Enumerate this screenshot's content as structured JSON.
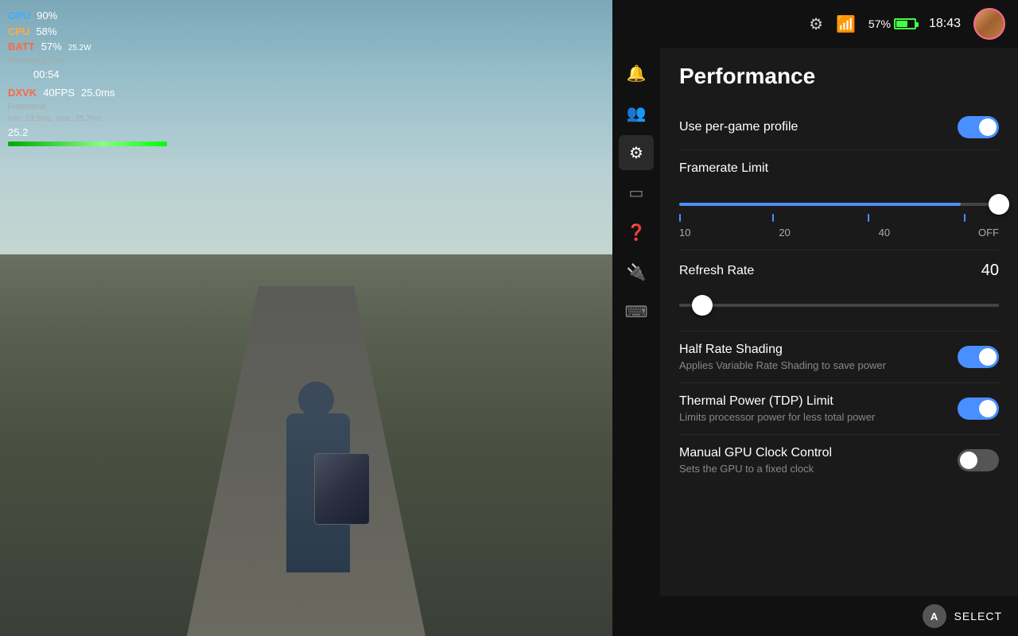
{
  "hud": {
    "gpu_label": "GPU",
    "gpu_value": "90%",
    "cpu_label": "CPU",
    "cpu_value": "58%",
    "batt_label": "BATT",
    "batt_value": "57%",
    "batt_watt": "25.2W",
    "batt_remaining": "Remaining Time",
    "batt_time": "00:54",
    "dxvk_label": "DXVK",
    "dxvk_fps": "40FPS",
    "dxvk_ms": "25.0ms",
    "frametime_label": "Frametime",
    "frametime_detail": "min: 19.5ms, max: 25.7ms",
    "frametime_val": "25.2"
  },
  "topbar": {
    "battery_pct": "57%",
    "time": "18:43"
  },
  "panel": {
    "title": "Performance",
    "settings": [
      {
        "id": "per-game-profile",
        "label": "Use per-game profile",
        "type": "toggle",
        "value": true
      }
    ],
    "framerate_section": {
      "label": "Framerate Limit",
      "ticks": [
        "10",
        "20",
        "40",
        "OFF"
      ]
    },
    "refresh_rate": {
      "label": "Refresh Rate",
      "value": "40"
    },
    "half_rate_shading": {
      "label": "Half Rate Shading",
      "sublabel": "Applies Variable Rate Shading to save power",
      "value": true
    },
    "tdp_limit": {
      "label": "Thermal Power (TDP) Limit",
      "sublabel": "Limits processor power for less total power",
      "value": true
    },
    "gpu_clock": {
      "label": "Manual GPU Clock Control",
      "sublabel": "Sets the GPU to a fixed clock",
      "value": false
    }
  },
  "sidebar": {
    "icons": [
      {
        "id": "notification",
        "symbol": "🔔"
      },
      {
        "id": "friends",
        "symbol": "👥"
      },
      {
        "id": "settings",
        "symbol": "⚙"
      },
      {
        "id": "display",
        "symbol": "🖥"
      },
      {
        "id": "help",
        "symbol": "❓"
      },
      {
        "id": "power",
        "symbol": "🔌"
      },
      {
        "id": "keyboard",
        "symbol": "⌨"
      }
    ]
  },
  "bottom": {
    "select_label": "SELECT",
    "btn_label": "A"
  }
}
